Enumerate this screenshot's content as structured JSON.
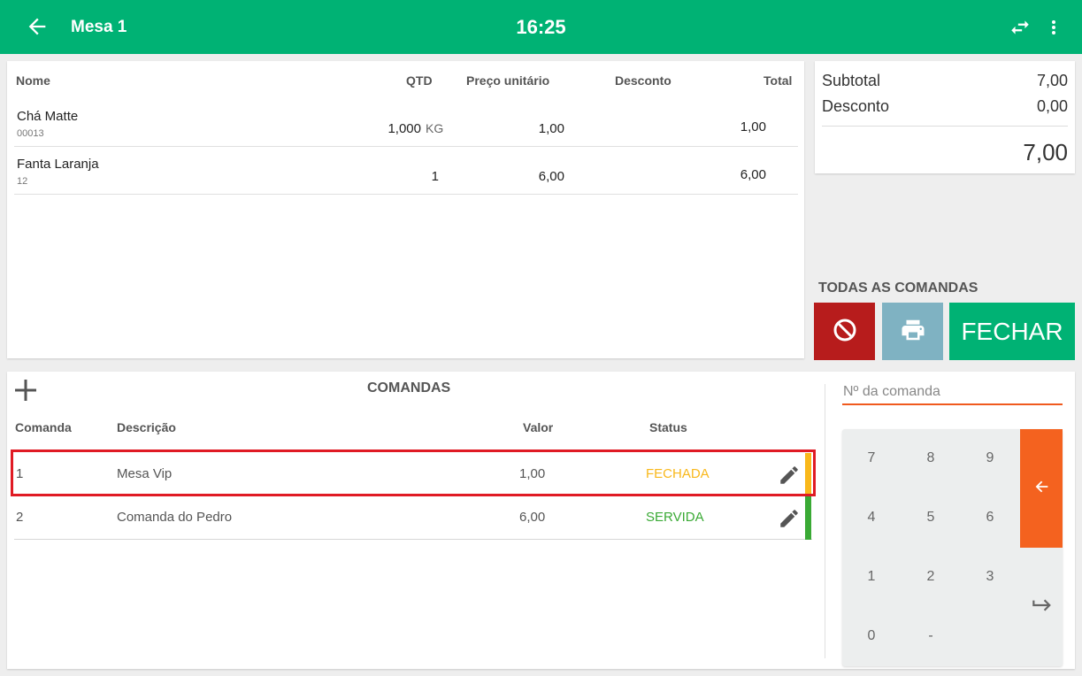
{
  "header": {
    "title": "Mesa 1",
    "clock": "16:25",
    "icons": [
      "arrow-left-icon",
      "swap-icon",
      "more-vertical-icon"
    ]
  },
  "items_table": {
    "columns": [
      "Nome",
      "QTD",
      "Preço unitário",
      "Desconto",
      "Total"
    ],
    "rows": [
      {
        "name": "Chá Matte",
        "code": "00013",
        "qty": "1,000",
        "unit": "KG",
        "price": "1,00",
        "discount": "",
        "total": "1,00"
      },
      {
        "name": "Fanta Laranja",
        "code": "12",
        "qty": "1",
        "unit": "",
        "price": "6,00",
        "discount": "",
        "total": "6,00"
      }
    ]
  },
  "totals": {
    "subtotal_label": "Subtotal",
    "subtotal_value": "7,00",
    "discount_label": "Desconto",
    "discount_value": "0,00",
    "grand_total": "7,00"
  },
  "actions": {
    "section_label": "TODAS AS COMANDAS",
    "close_label": "FECHAR",
    "cancel_icon": "block-icon",
    "print_icon": "printer-icon"
  },
  "comandas": {
    "title": "COMANDAS",
    "columns": [
      "Comanda",
      "Descrição",
      "Valor",
      "Status"
    ],
    "rows": [
      {
        "number": "1",
        "description": "Mesa Vip",
        "value": "1,00",
        "status": "FECHADA",
        "status_color": "#f9b81b"
      },
      {
        "number": "2",
        "description": "Comanda do Pedro",
        "value": "6,00",
        "status": "SERVIDA",
        "status_color": "#3aaa35"
      }
    ]
  },
  "keypad": {
    "input_placeholder": "Nº da comanda",
    "input_value": "",
    "keys": [
      "7",
      "8",
      "9",
      "4",
      "5",
      "6",
      "1",
      "2",
      "3",
      "0",
      "-"
    ],
    "backspace_icon": "backspace-arrow-icon",
    "enter_icon": "enter-return-icon"
  },
  "colors": {
    "primary": "#00b274",
    "danger": "#b71c1c",
    "print": "#7fb2c2",
    "accent": "#f4621f",
    "highlight": "#e01b24"
  }
}
